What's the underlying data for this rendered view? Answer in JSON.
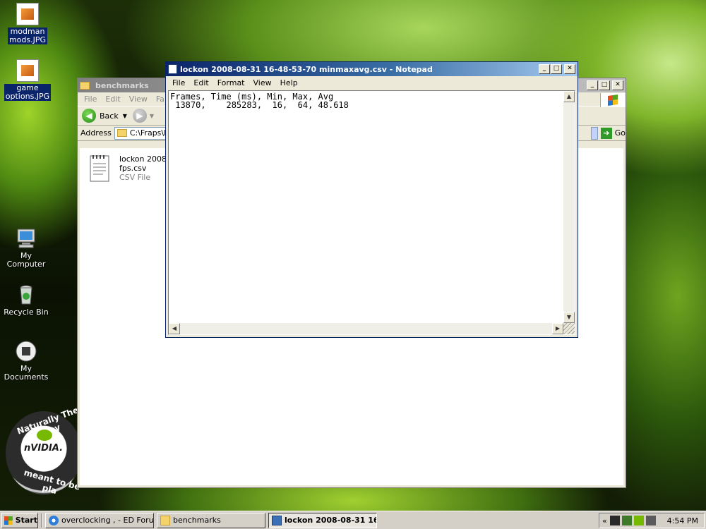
{
  "desktop": {
    "icons": [
      {
        "label_line1": "modman",
        "label_line2": "mods.JPG"
      },
      {
        "label_line1": "game",
        "label_line2": "options.JPG"
      },
      {
        "label_line1": "My Computer",
        "label_line2": ""
      },
      {
        "label_line1": "Recycle Bin",
        "label_line2": ""
      },
      {
        "label_line1": "My Documents",
        "label_line2": ""
      }
    ],
    "nvidia_badge": {
      "top": "Naturally The way",
      "logo": "nVIDIA.",
      "bottom": "meant to be pla"
    }
  },
  "explorer": {
    "title": "benchmarks",
    "menu": [
      "File",
      "Edit",
      "View",
      "Fa"
    ],
    "back_label": "Back",
    "address_label": "Address",
    "address_value": "C:\\Fraps\\be",
    "go_label": "Go",
    "file": {
      "name_line1": "lockon 2008-0",
      "name_line2": "fps.csv",
      "type": "CSV File"
    }
  },
  "notepad": {
    "title": "lockon 2008-08-31 16-48-53-70 minmaxavg.csv - Notepad",
    "menu": [
      "File",
      "Edit",
      "Format",
      "View",
      "Help"
    ],
    "content_line1": "Frames, Time (ms), Min, Max, Avg",
    "content_line2": " 13870,    285283,  16,  64, 48.618"
  },
  "taskbar": {
    "start_label": "Start",
    "tasks": [
      {
        "label": "overclocking , - ED Foru..."
      },
      {
        "label": "benchmarks"
      },
      {
        "label": "lockon 2008-08-31 16..."
      }
    ],
    "tray_chevron": "«",
    "clock": "4:54 PM"
  },
  "colors": {
    "title_active": "#0a246a",
    "title_inactive": "#808080",
    "window_face": "#ece9d8"
  }
}
